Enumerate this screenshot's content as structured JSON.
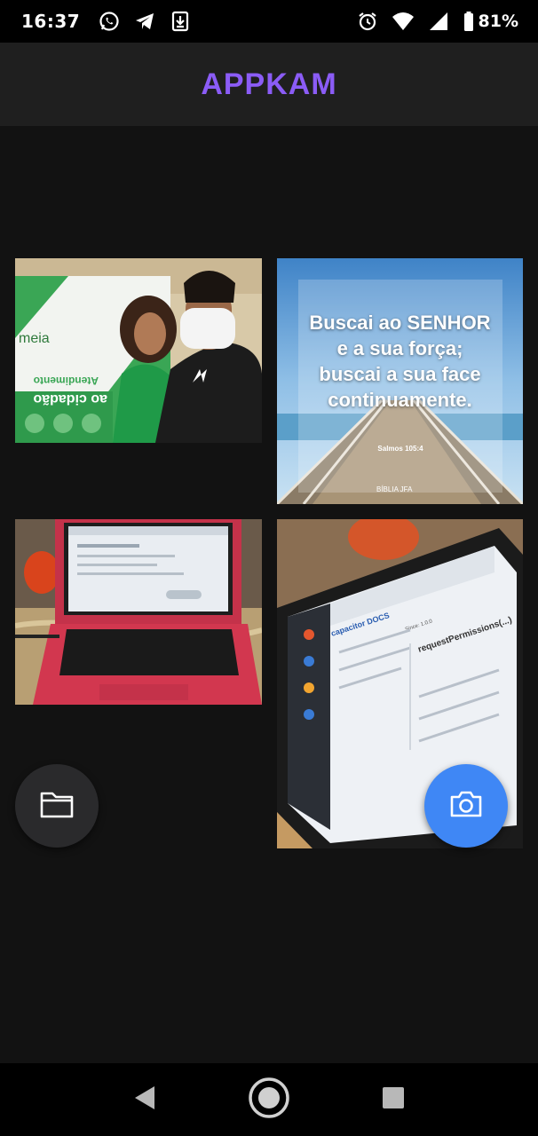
{
  "status_bar": {
    "time": "16:37",
    "battery": "81%",
    "left_icons": [
      "whatsapp-icon",
      "telegram-icon",
      "download-icon"
    ],
    "right_icons": [
      "alarm-icon",
      "wifi-icon",
      "signal-icon",
      "battery-icon"
    ]
  },
  "app_bar": {
    "title": "APPKAM",
    "title_color": "#8b5cf6"
  },
  "gallery": {
    "photos": [
      {
        "name": "photo-man-with-mask-banner",
        "banner_text": [
          "meia",
          "Atendimento",
          "ao cidadão"
        ]
      },
      {
        "name": "photo-bible-verse-pier",
        "verse": "Buscai ao SENHOR e a sua força; buscai a sua face continuamente.",
        "reference": "Salmos 105:4",
        "brand": "BÍBLIA JFA"
      },
      {
        "name": "photo-red-laptop"
      },
      {
        "name": "photo-capacitor-docs-screen",
        "screen_text": [
          "capacitor DOCS",
          "requestPermissions(...)",
          "Since: 1.0.0"
        ]
      }
    ]
  },
  "fabs": {
    "files": {
      "icon": "folder-icon",
      "color": "#2a2a2c"
    },
    "camera": {
      "icon": "camera-icon",
      "color": "#3f87f5"
    }
  },
  "nav_bar": {
    "buttons": [
      "back-icon",
      "home-icon",
      "recents-icon"
    ]
  }
}
